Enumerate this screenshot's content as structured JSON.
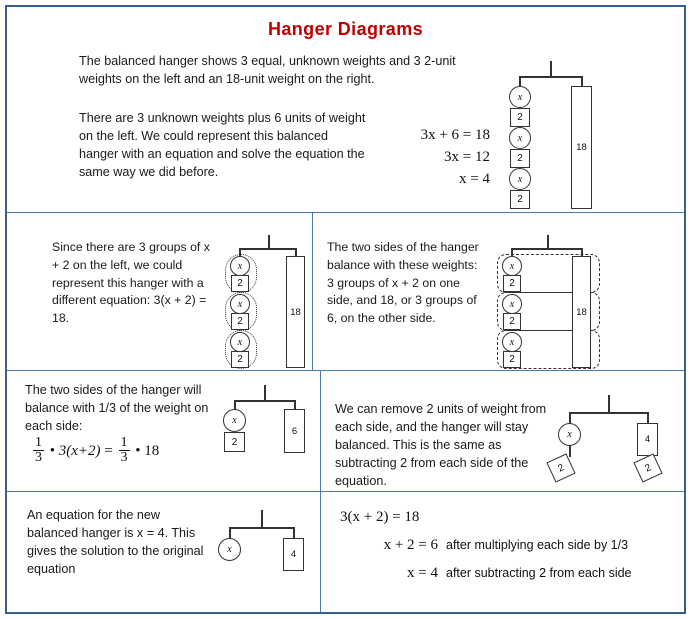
{
  "title": "Hanger Diagrams",
  "theme": {
    "frame_border": "#365F91",
    "divider": "#4A7AB0",
    "title_color": "#C00000",
    "ink": "#333333",
    "text": "#1A1A1A"
  },
  "rows": {
    "row1": {
      "paragraph_1": "The balanced hanger shows 3 equal, unknown weights and 3 2-unit weights on the left and an 18-unit weight on the right.",
      "paragraph_2": "There are 3 unknown weights plus 6 units of weight on the left. We could represent this balanced hanger with an equation and solve the equation the same way we did before.",
      "equations": [
        {
          "lhs": "3x + 6",
          "rhs": "18",
          "text": "3x + 6 = 18"
        },
        {
          "lhs": "3x",
          "rhs": "12",
          "text": "3x = 12"
        },
        {
          "lhs": "x",
          "rhs": "4",
          "text": "x = 4"
        }
      ],
      "hanger": {
        "left_weights": [
          "x",
          "2",
          "x",
          "2",
          "x",
          "2"
        ],
        "right_weight": "18"
      }
    },
    "row2_left": {
      "paragraph": "Since there are 3 groups of x + 2 on the left, we could represent this hanger with a different equation: 3(x + 2) = 18.",
      "hanger": {
        "left_weights": [
          "x",
          "2",
          "x",
          "2",
          "x",
          "2"
        ],
        "right_weight": "18",
        "grouping": "3 dotted ovals around each x+2 pair"
      }
    },
    "row2_right": {
      "paragraph": "The two sides of the hanger balance with these weights: 3 groups of x + 2 on one side, and 18, or 3 groups of 6, on the other side.",
      "hanger": {
        "left_weights": [
          "x",
          "2",
          "x",
          "2",
          "x",
          "2"
        ],
        "right_weight": "18",
        "grouping": "3 dashed rectangles spanning both sides"
      }
    },
    "row3_left": {
      "paragraph": "The two sides of the hanger will balance with 1/3 of the weight on each side:",
      "equation": {
        "text": "1/3 • 3(x + 2) = 1/3 • 18",
        "frac_num": "1",
        "frac_den": "3",
        "dot": "•",
        "left_expr": "3(x+2)",
        "equals": "=",
        "right_expr": "18"
      },
      "hanger": {
        "left_weights": [
          "x",
          "2"
        ],
        "right_weight": "6"
      }
    },
    "row3_right": {
      "paragraph": "We can remove 2 units of weight from each side, and the hanger will stay balanced. This is the same as subtracting 2 from each side of the equation.",
      "hanger": {
        "left_weights": [
          "x"
        ],
        "left_removed": "2",
        "right_weight": "4",
        "right_removed": "2"
      }
    },
    "row4_left": {
      "paragraph": "An equation for the new balanced hanger is x = 4. This gives the solution to the original equation",
      "hanger": {
        "left_weights": [
          "x"
        ],
        "right_weight": "4"
      }
    },
    "row4_right": {
      "steps": [
        {
          "equation": "3(x + 2) = 18",
          "note": ""
        },
        {
          "equation": "x + 2 = 6",
          "note": "after multiplying each side by 1/3"
        },
        {
          "equation": "x = 4",
          "note": "after subtracting 2 from each side"
        }
      ]
    }
  }
}
